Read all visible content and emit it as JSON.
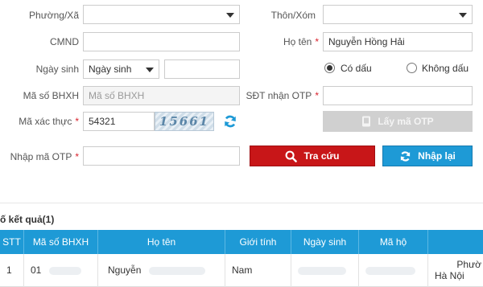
{
  "form": {
    "ward_label": "Phường/Xã",
    "hamlet_label": "Thôn/Xóm",
    "cmnd_label": "CMND",
    "cmnd_value": "",
    "name_label": "Họ tên",
    "name_value": "Nguyễn Hồng Hải",
    "dob_label": "Ngày sinh",
    "dob_select": "Ngày sinh",
    "dob_value": "",
    "accent_on_label": "Có dấu",
    "accent_off_label": "Không dấu",
    "bhxh_label": "Mã số BHXH",
    "bhxh_placeholder": "Mã số BHXH",
    "phone_label": "SĐT nhận OTP",
    "phone_value": "",
    "captcha_label": "Mã xác thực",
    "captcha_value": "54321",
    "captcha_image_text": "15661",
    "get_otp_label": "Lấy mã OTP",
    "otp_label": "Nhập mã OTP",
    "otp_value": "",
    "search_label": "Tra cứu",
    "reset_label": "Nhập lại",
    "required_mark": "*"
  },
  "results": {
    "title": "ố kết quả(1)",
    "columns": [
      "STT",
      "Mã số BHXH",
      "Họ tên",
      "Giới tính",
      "Ngày sinh",
      "Mã hộ",
      ""
    ],
    "rows": [
      {
        "stt": "1",
        "bhxh": "01",
        "name": "Nguyễn",
        "gender": "Nam",
        "dob": "",
        "household": "",
        "address_1": "Phườ",
        "address_2": "Hà Nội"
      }
    ]
  },
  "colors": {
    "header_blue": "#1e9ad6",
    "search_red": "#c81618",
    "required_red": "#d9232d",
    "disabled_grey": "#d0d0d0"
  },
  "icons": {
    "search": "search-icon",
    "refresh": "refresh-icon",
    "otp": "phone-icon",
    "reset": "refresh-icon"
  }
}
